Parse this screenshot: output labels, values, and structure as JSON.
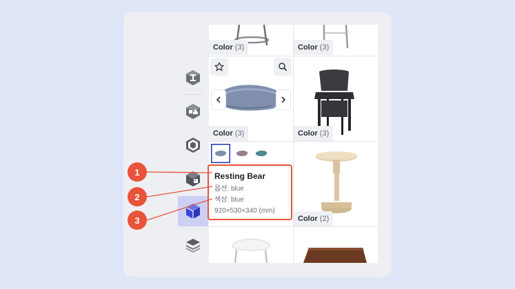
{
  "rail": {
    "items": [
      {
        "icon": "beam-icon"
      },
      {
        "icon": "furniture-set-icon"
      },
      {
        "icon": "cube-wire-icon"
      },
      {
        "icon": "box-image-icon"
      },
      {
        "icon": "cube-blue-icon",
        "active": true
      },
      {
        "icon": "layers-icon"
      }
    ]
  },
  "grid": {
    "row1": {
      "left_tag": {
        "label": "Color",
        "count": "(3)"
      },
      "right_tag": {
        "label": "Color",
        "count": "(3)"
      }
    },
    "row2": {
      "left_tag": {
        "label": "Color",
        "count": "(3)"
      },
      "right_tag": {
        "label": "Color",
        "count": "(3)"
      }
    },
    "row3": {
      "right_tag": {
        "label": "Color",
        "count": "(2)"
      }
    }
  },
  "tooltip": {
    "title": "Resting Bear",
    "option": "옵션: blue",
    "color": "색상: blue",
    "size": "920×530×340 (mm)"
  },
  "callouts": [
    "1",
    "2",
    "3"
  ],
  "colors": {
    "accent": "#e8533a",
    "selection": "#2233b8"
  }
}
